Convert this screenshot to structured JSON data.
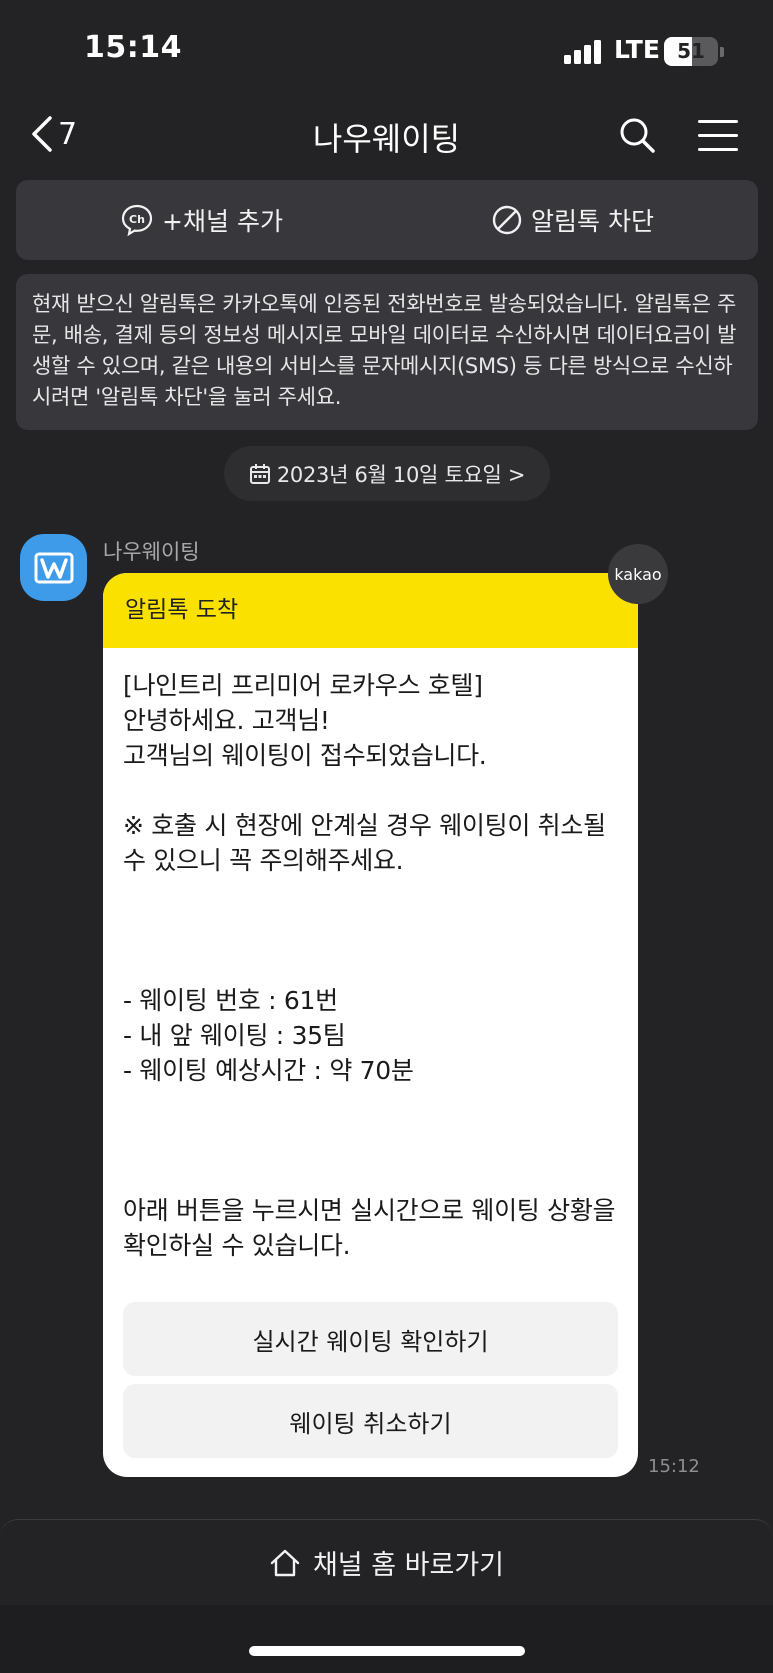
{
  "status_bar": {
    "time": "15:14",
    "network": "LTE",
    "battery": "51",
    "battery_level": 0.51
  },
  "nav": {
    "back_count": "7",
    "title": "나우웨이팅",
    "icons": {
      "back": "chevron-left-icon",
      "search": "search-icon",
      "menu": "hamburger-menu-icon"
    }
  },
  "channel_actions": {
    "add_channel": "+채널 추가",
    "block_alimtalk": "알림톡 차단",
    "icons": {
      "add": "channel-ch-icon",
      "block": "block-icon"
    }
  },
  "notice": {
    "text": "현재 받으신 알림톡은 카카오톡에 인증된 전화번호로 발송되었습니다. 알림톡은 주문, 배송, 결제 등의 정보성 메시지로 모바일 데이터로 수신하시면 데이터요금이 발생할 수 있으며, 같은 내용의 서비스를 문자메시지(SMS) 등 다른 방식으로 수신하시려면 '알림톡 차단'을 눌러 주세요."
  },
  "date_divider": {
    "label": "2023년 6월 10일 토요일 >",
    "icon": "calendar-icon"
  },
  "message": {
    "sender": "나우웨이팅",
    "avatar_icon": "nowwaiting-logo-icon",
    "badge": "kakao",
    "header": "알림톡 도착",
    "lines": {
      "hotel": "[나인트리 프리미어 로카우스 호텔]",
      "greeting": "안녕하세요. 고객님!",
      "received": "고객님의 웨이팅이 접수되었습니다.",
      "warning": "※ 호출 시 현장에 안계실 경우 웨이팅이 취소될 수 있으니 꼭 주의해주세요.",
      "number": "- 웨이팅 번호 : 61번",
      "ahead": "- 내 앞 웨이팅 : 35팀",
      "eta": "- 웨이팅 예상시간 : 약 70분",
      "instruction": "아래 버튼을 누르시면 실시간으로 웨이팅 상황을 확인하실 수 있습니다."
    },
    "buttons": {
      "check_realtime": "실시간 웨이팅 확인하기",
      "cancel": "웨이팅 취소하기"
    },
    "time": "15:12"
  },
  "footer": {
    "channel_home": "채널 홈 바로가기",
    "icon": "home-icon"
  },
  "colors": {
    "background": "#232326",
    "panel": "#38383c",
    "card_header": "#fae100",
    "avatar": "#3d9be9"
  }
}
